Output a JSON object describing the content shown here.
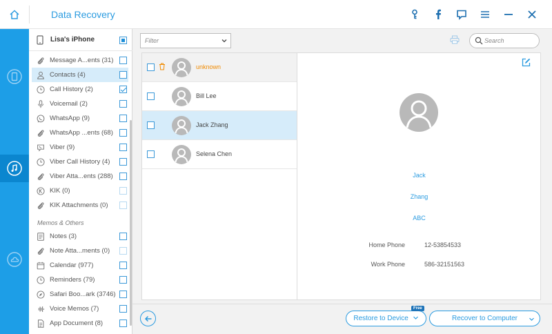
{
  "app": {
    "title": "Data Recovery",
    "accent_color": "#1d9ee7",
    "titlebar_icons": [
      "key-icon",
      "facebook-icon",
      "feedback-icon",
      "menu-icon",
      "minimize-icon",
      "close-icon"
    ]
  },
  "device": {
    "name": "Lisa's iPhone"
  },
  "categories": [
    {
      "label": "Message A...ents (31)",
      "icon": "paperclip-icon",
      "checked": false
    },
    {
      "label": "Contacts (4)",
      "icon": "person-icon",
      "checked": false,
      "selected": true
    },
    {
      "label": "Call History (2)",
      "icon": "clock-icon",
      "checked": true
    },
    {
      "label": "Voicemail (2)",
      "icon": "microphone-icon",
      "checked": false
    },
    {
      "label": "WhatsApp (9)",
      "icon": "whatsapp-icon",
      "checked": false
    },
    {
      "label": "WhatsApp ...ents (68)",
      "icon": "paperclip-icon",
      "checked": false
    },
    {
      "label": "Viber (9)",
      "icon": "viber-icon",
      "checked": false
    },
    {
      "label": "Viber Call History (4)",
      "icon": "clock-icon",
      "checked": false
    },
    {
      "label": "Viber Atta...ents (288)",
      "icon": "paperclip-icon",
      "checked": false
    },
    {
      "label": "KIK (0)",
      "icon": "kik-icon",
      "checked": false,
      "disabled": true
    },
    {
      "label": "KIK Attachments (0)",
      "icon": "paperclip-icon",
      "checked": false,
      "disabled": true
    }
  ],
  "section_memos": "Memos & Others",
  "memos": [
    {
      "label": "Notes (3)",
      "icon": "note-icon",
      "checked": false
    },
    {
      "label": "Note Atta...ments (0)",
      "icon": "paperclip-icon",
      "checked": false,
      "disabled": true
    },
    {
      "label": "Calendar (977)",
      "icon": "calendar-icon",
      "checked": false
    },
    {
      "label": "Reminders (79)",
      "icon": "clock-icon",
      "checked": false
    },
    {
      "label": "Safari Boo...ark (3746)",
      "icon": "compass-icon",
      "checked": false
    },
    {
      "label": "Voice Memos (7)",
      "icon": "waveform-icon",
      "checked": false
    },
    {
      "label": "App Document (8)",
      "icon": "document-icon",
      "checked": false
    }
  ],
  "toolbar": {
    "filter_placeholder": "Filter",
    "search_placeholder": "Search"
  },
  "contacts": [
    {
      "name": "unknown",
      "deleted": true
    },
    {
      "name": "Bill Lee"
    },
    {
      "name": "Jack Zhang",
      "selected": true
    },
    {
      "name": "Selena  Chen"
    }
  ],
  "detail": {
    "first_name": "Jack",
    "last_name": "Zhang",
    "company": "ABC",
    "fields": [
      {
        "key": "Home Phone",
        "value": "12-53854533"
      },
      {
        "key": "Work Phone",
        "value": "586-32151563"
      }
    ]
  },
  "footer": {
    "restore_device_label": "Restore to Device",
    "free_badge": "Free",
    "recover_computer_label": "Recover to Computer"
  }
}
